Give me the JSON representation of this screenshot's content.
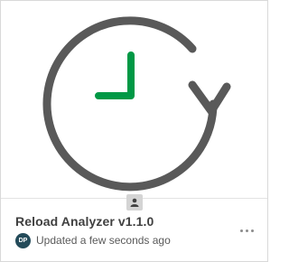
{
  "card": {
    "title": "Reload Analyzer v1.1.0",
    "owner_initials": "DP",
    "updated_text": "Updated a few seconds ago",
    "thumbnail_icon": "clock-reload-icon",
    "owner_chip_icon": "person-icon",
    "more_icon": "more-horizontal-icon"
  },
  "colors": {
    "clock_outline": "#595959",
    "clock_hands": "#009845",
    "avatar_bg": "#244b5a",
    "title_text": "#404040"
  }
}
